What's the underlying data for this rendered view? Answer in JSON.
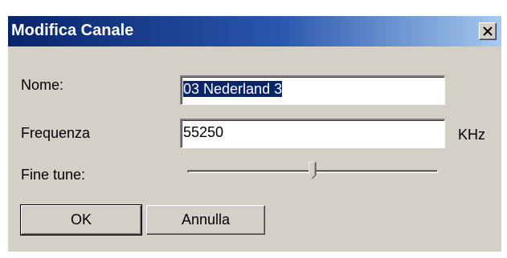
{
  "window": {
    "title": "Modifica Canale",
    "close_icon": "close-icon"
  },
  "form": {
    "name_label": "Nome:",
    "name_value": "03 Nederland 3",
    "frequency_label": "Frequenza",
    "frequency_value": "55250",
    "frequency_unit": "KHz",
    "fine_tune_label": "Fine tune:",
    "fine_tune_level": 0.5
  },
  "buttons": {
    "ok_label": "OK",
    "cancel_label": "Annulla"
  },
  "colors": {
    "title_gradient_start": "#08246b",
    "title_gradient_end": "#a6caf0",
    "dialog_face": "#d4d0c8",
    "selection": "#0a246a"
  }
}
